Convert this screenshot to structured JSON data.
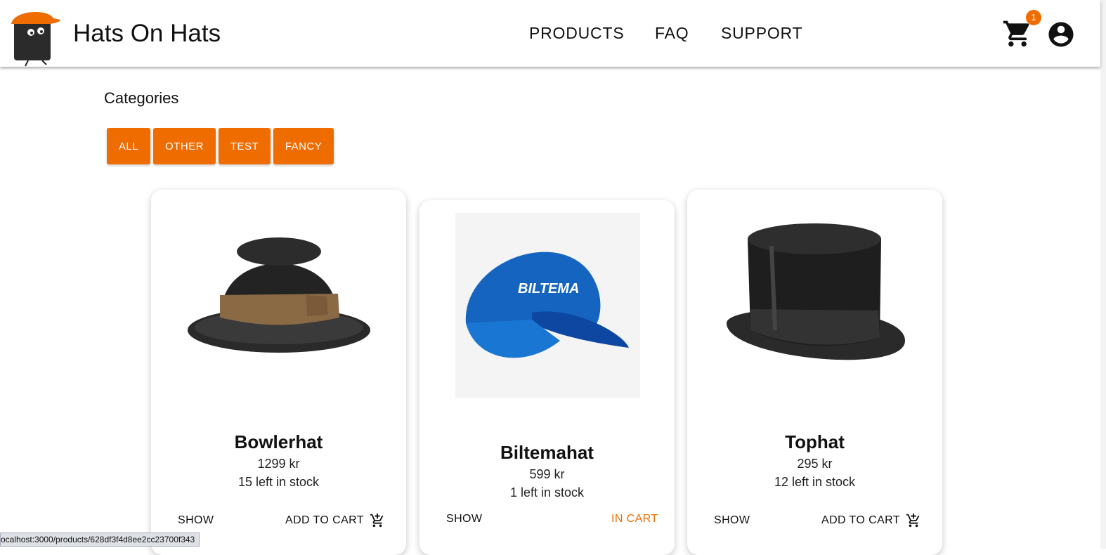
{
  "header": {
    "brand": "Hats On Hats",
    "nav": [
      "PRODUCTS",
      "FAQ",
      "SUPPORT"
    ],
    "cart_count": "1"
  },
  "categories": {
    "title": "Categories",
    "buttons": [
      "ALL",
      "OTHER",
      "TEST",
      "FANCY"
    ]
  },
  "products": [
    {
      "name": "Bowlerhat",
      "price": "1299 kr",
      "stock": "15 left in stock",
      "show": "SHOW",
      "action": "ADD TO CART"
    },
    {
      "name": "Biltemahat",
      "price": "599 kr",
      "stock": "1 left in stock",
      "show": "SHOW",
      "action": "IN CART",
      "cap_text": "BILTEMA"
    },
    {
      "name": "Tophat",
      "price": "295 kr",
      "stock": "12 left in stock",
      "show": "SHOW",
      "action": "ADD TO CART"
    }
  ],
  "status_url": "ocalhost:3000/products/628df3f4d8ee2cc23700f343",
  "colors": {
    "accent": "#ef6c00"
  }
}
